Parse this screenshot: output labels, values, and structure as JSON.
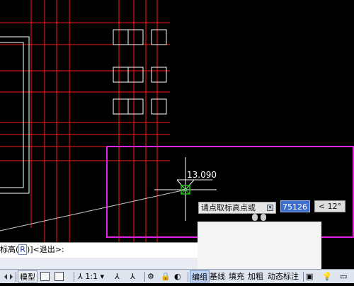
{
  "canvas": {
    "dimension_value": "13.090"
  },
  "tooltip": {
    "prompt": "请点取标高点或",
    "elevation_value": "75126",
    "angle": "< 12°",
    "arrow_glyph": "▾"
  },
  "command_line": {
    "prefix": "标高",
    "option_key": "R",
    "suffix": "]<退出>:"
  },
  "status_bar": {
    "model_label": "模型",
    "scale_label": "1:1",
    "items": [
      "编组",
      "基线",
      "填充",
      "加粗",
      "动态标注"
    ],
    "active_item": "编组"
  },
  "colors": {
    "background": "#000000",
    "grid_line": "#ff1a1a",
    "window_outline": "#ffffff",
    "selection_frame": "#e020e0",
    "crosshair": "#ffffff",
    "snap_marker": "#22c222"
  }
}
